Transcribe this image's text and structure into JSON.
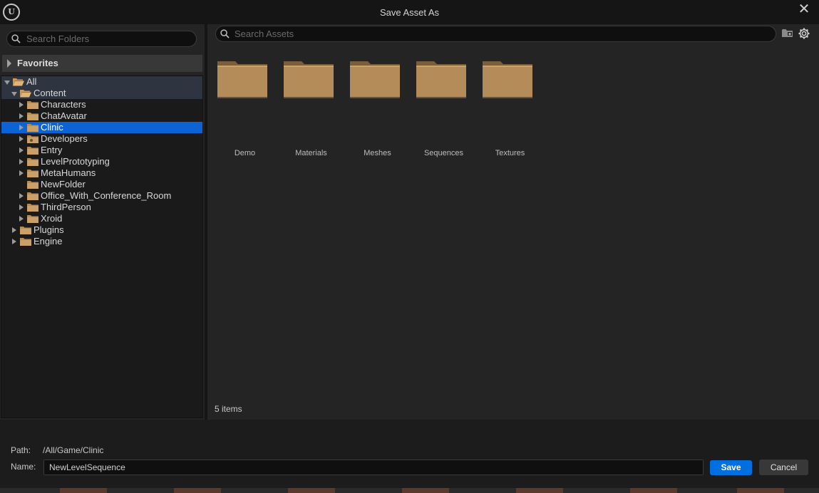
{
  "window": {
    "title": "Save Asset As",
    "close_icon": "close-icon",
    "logo": "unreal-logo-icon"
  },
  "left": {
    "search_placeholder": "Search Folders",
    "favorites_label": "Favorites",
    "tree": [
      {
        "label": "All",
        "expanded": true,
        "icon": "folder-open-icon"
      },
      {
        "label": "Content",
        "expanded": true,
        "icon": "folder-open-icon"
      },
      {
        "label": "Characters",
        "icon": "folder-icon"
      },
      {
        "label": "ChatAvatar",
        "icon": "folder-icon"
      },
      {
        "label": "Clinic",
        "icon": "folder-icon",
        "selected": true
      },
      {
        "label": "Developers",
        "icon": "developer-folder-icon"
      },
      {
        "label": "Entry",
        "icon": "folder-icon"
      },
      {
        "label": "LevelPrototyping",
        "icon": "folder-icon"
      },
      {
        "label": "MetaHumans",
        "icon": "folder-icon"
      },
      {
        "label": "NewFolder",
        "icon": "folder-icon"
      },
      {
        "label": "Office_With_Conference_Room",
        "icon": "folder-icon"
      },
      {
        "label": "ThirdPerson",
        "icon": "folder-icon"
      },
      {
        "label": "Xroid",
        "icon": "folder-icon"
      },
      {
        "label": "Plugins",
        "icon": "folder-icon"
      },
      {
        "label": "Engine",
        "icon": "folder-icon"
      }
    ]
  },
  "right": {
    "search_placeholder": "Search Assets",
    "assets": [
      {
        "label": "Demo"
      },
      {
        "label": "Materials"
      },
      {
        "label": "Meshes"
      },
      {
        "label": "Sequences"
      },
      {
        "label": "Textures"
      }
    ],
    "item_count": "5 items"
  },
  "bottom": {
    "path_label": "Path:",
    "path_value": "/All/Game/Clinic",
    "name_label": "Name:",
    "name_value": "NewLevelSequence",
    "save_label": "Save",
    "cancel_label": "Cancel"
  },
  "colors": {
    "accent": "#0070e0",
    "selection": "#0b63d6",
    "folder": "#b48c5a"
  }
}
